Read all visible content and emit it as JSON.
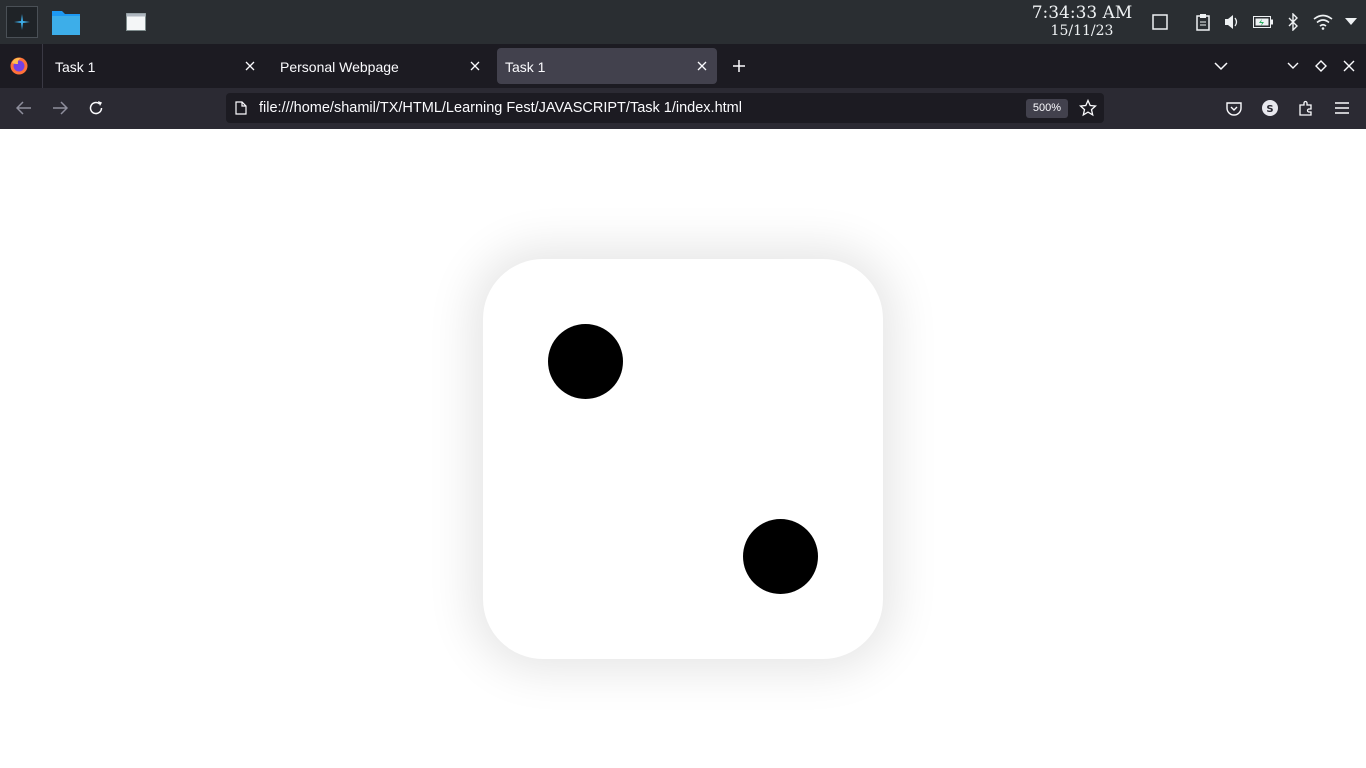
{
  "taskbar": {
    "time": "7:34:33 AM",
    "date": "15/11/23",
    "icons": [
      "app-launcher-icon",
      "file-manager-icon",
      "window-icon",
      "desktop-icon",
      "clipboard-icon",
      "volume-icon",
      "battery-icon",
      "bluetooth-icon",
      "wifi-icon",
      "tray-expand-icon"
    ]
  },
  "browser": {
    "tabs": [
      {
        "label": "Task 1",
        "active": false
      },
      {
        "label": "Personal Webpage",
        "active": false
      },
      {
        "label": "Task 1",
        "active": true
      }
    ],
    "url": "file:///home/shamil/TX/HTML/Learning Fest/JAVASCRIPT/Task 1/index.html",
    "zoom": "500%",
    "accent": "#42414d"
  },
  "page": {
    "dice_face_value": 2,
    "dice_color": "#ffffff",
    "pip_color": "#000000"
  }
}
